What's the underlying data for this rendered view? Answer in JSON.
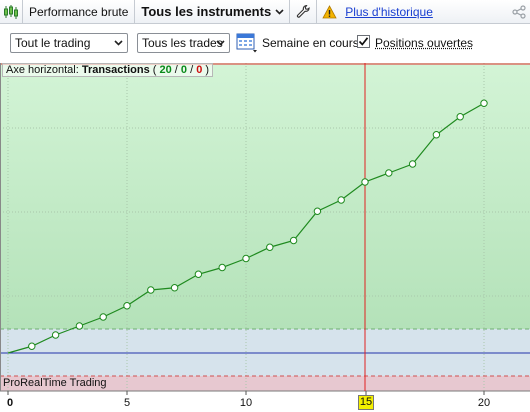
{
  "toolbar": {
    "performance_label": "Performance brute",
    "instruments_label": "Tous les instruments",
    "history_link": "Plus d'historique",
    "icons": [
      "candlestick-icon",
      "chevron-down-icon",
      "wrench-icon",
      "warning-icon",
      "share-icon"
    ]
  },
  "filters": {
    "trading_select": "Tout le trading",
    "trades_select": "Tous les trades",
    "week_label": "Semaine en cours",
    "positions_label": "Positions ouvertes",
    "positions_checked": true
  },
  "chart": {
    "axis_prefix": "Axe horizontal: ",
    "axis_name": "Transactions",
    "count_open": "( ",
    "count_total": "20",
    "count_sep1": " / ",
    "count_a": "0",
    "count_sep2": " / ",
    "count_b": "0",
    "count_close": " )",
    "brand": "ProRealTime Trading",
    "highlight_x": "15",
    "colors": {
      "positive_zone": "#c8efcc",
      "neutral_zone": "#d4e2ea",
      "negative_zone": "#e8c9d0",
      "line": "#1f8a1f",
      "zero_line": "#2233aa",
      "crosshair": "#e02020"
    }
  },
  "chart_data": {
    "type": "line",
    "xlabel": "Transactions",
    "x_ticks": [
      "0",
      "5",
      "10",
      "15",
      "20"
    ],
    "x": [
      0,
      1,
      2,
      3,
      4,
      5,
      6,
      7,
      8,
      9,
      10,
      11,
      12,
      13,
      14,
      15,
      16,
      17,
      18,
      19,
      20
    ],
    "y": [
      0,
      3,
      8,
      12,
      16,
      21,
      28,
      29,
      35,
      38,
      42,
      47,
      50,
      63,
      68,
      76,
      80,
      84,
      97,
      105,
      111
    ],
    "xlim": [
      0,
      21.5
    ],
    "ylim": [
      -8,
      120
    ],
    "crosshair_x": 15
  }
}
